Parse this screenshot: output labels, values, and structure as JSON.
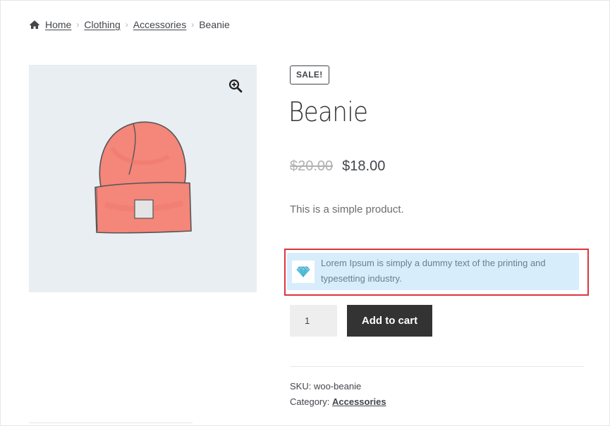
{
  "breadcrumb": {
    "home_icon": "home-icon",
    "items": [
      "Home",
      "Clothing",
      "Accessories"
    ],
    "current": "Beanie"
  },
  "gallery": {
    "zoom_icon": "magnifier-plus-icon",
    "image_subject": "beanie"
  },
  "product": {
    "badge": "SALE!",
    "title": "Beanie",
    "price_old": "$20.00",
    "price_new": "$18.00",
    "short_description": "This is a simple product."
  },
  "notice": {
    "icon": "diamond-icon",
    "text": "Lorem Ipsum is simply a dummy text of the printing and typesetting industry."
  },
  "cart": {
    "quantity": "1",
    "add_label": "Add to cart"
  },
  "meta": {
    "sku_label": "SKU:",
    "sku_value": "woo-beanie",
    "category_label": "Category:",
    "category_value": "Accessories"
  },
  "colors": {
    "highlight_border": "#d9363e",
    "notice_bg": "#d8edfb",
    "button_bg": "#333333",
    "gallery_bg": "#e9eef2",
    "hat_fill": "#f4867a"
  }
}
